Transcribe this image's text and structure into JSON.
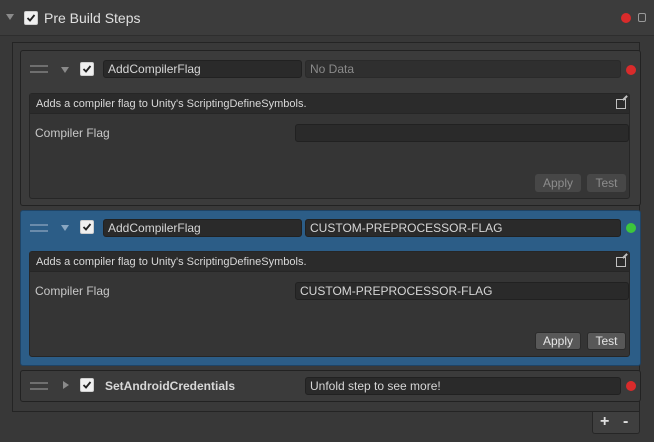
{
  "header": {
    "title": "Pre Build Steps",
    "checked": true,
    "status_color": "#d92b2b"
  },
  "steps": [
    {
      "name": "AddCompilerFlag",
      "value": "No Data",
      "checked": true,
      "status_color": "#d92b2b",
      "expanded": true,
      "description": "Adds a compiler flag to Unity's ScriptingDefineSymbols.",
      "field_label": "Compiler Flag",
      "field_value": "",
      "apply_label": "Apply",
      "test_label": "Test"
    },
    {
      "name": "AddCompilerFlag",
      "value": "CUSTOM-PREPROCESSOR-FLAG",
      "checked": true,
      "status_color": "#3cc63c",
      "selected": true,
      "expanded": true,
      "description": "Adds a compiler flag to Unity's ScriptingDefineSymbols.",
      "field_label": "Compiler Flag",
      "field_value": "CUSTOM-PREPROCESSOR-FLAG",
      "apply_label": "Apply",
      "test_label": "Test"
    },
    {
      "name": "SetAndroidCredentials",
      "value": "Unfold step to see more!",
      "checked": true,
      "status_color": "#d92b2b",
      "expanded": false
    }
  ],
  "footer": {
    "add_label": "+",
    "remove_label": "-"
  },
  "colors": {
    "selected_bg": "#2c5d87",
    "background": "#383838"
  }
}
